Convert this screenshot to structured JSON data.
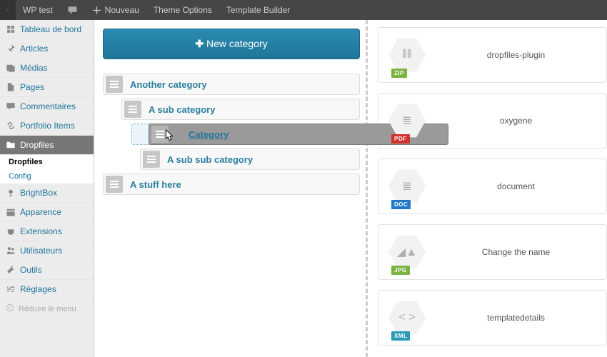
{
  "adminbar": {
    "site_name": "WP test",
    "nouveau": "Nouveau",
    "theme_options": "Theme Options",
    "template_builder": "Template Builder"
  },
  "sidebar": {
    "items": [
      {
        "label": "Tableau de bord",
        "icon": "dashboard"
      },
      {
        "label": "Articles",
        "icon": "pin"
      },
      {
        "label": "Médias",
        "icon": "media"
      },
      {
        "label": "Pages",
        "icon": "page"
      },
      {
        "label": "Commentaires",
        "icon": "comment"
      },
      {
        "label": "Portfolio Items",
        "icon": "link"
      },
      {
        "label": "Dropfiles",
        "icon": "folder"
      },
      {
        "label": "BrightBox",
        "icon": "light"
      },
      {
        "label": "Apparence",
        "icon": "appearance"
      },
      {
        "label": "Extensions",
        "icon": "plugin"
      },
      {
        "label": "Utilisateurs",
        "icon": "users"
      },
      {
        "label": "Outils",
        "icon": "tools"
      },
      {
        "label": "Réglages",
        "icon": "settings"
      }
    ],
    "sub_dropfiles": "Dropfiles",
    "sub_config": "Config",
    "collapse": "Réduire le menu"
  },
  "main": {
    "new_category": "New category",
    "categories": {
      "c0": "Another category",
      "c1": "A sub category",
      "c2": "Category",
      "c3": "A sub sub category",
      "c4": "A stuff here"
    }
  },
  "files": [
    {
      "name": "dropfiles-plugin",
      "ext": "ZIP",
      "badge": "badge-zip"
    },
    {
      "name": "oxygene",
      "ext": "PDF",
      "badge": "badge-pdf"
    },
    {
      "name": "document",
      "ext": "DOC",
      "badge": "badge-doc"
    },
    {
      "name": "Change the name",
      "ext": "JPG",
      "badge": "badge-jpg"
    },
    {
      "name": "templatedetails",
      "ext": "XML",
      "badge": "badge-xml"
    }
  ]
}
